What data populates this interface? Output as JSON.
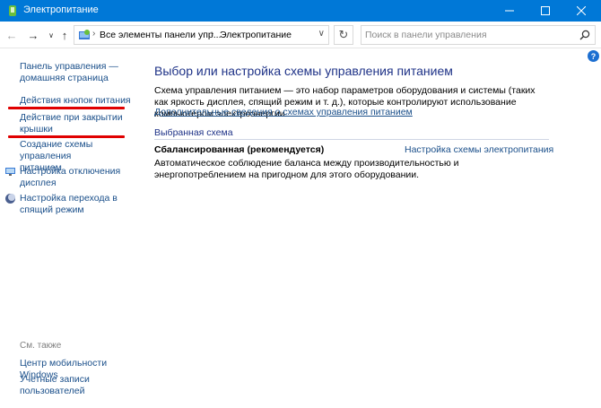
{
  "window": {
    "title": "Электропитание"
  },
  "address": {
    "crumbs": [
      "Все элементы панели упр...",
      "Электропитание"
    ]
  },
  "search": {
    "placeholder": "Поиск в панели управления"
  },
  "sidebar": {
    "items": [
      {
        "label": "Панель управления —\nдомашняя страница"
      },
      {
        "label": "Действия кнопок питания"
      },
      {
        "label": "Действие при закрытии\nкрышки"
      },
      {
        "label": "Создание схемы управления\nпитанием"
      },
      {
        "label": "Настройка отключения\nдисплея"
      },
      {
        "label": "Настройка перехода в\nспящий режим"
      }
    ],
    "see_also_title": "См. также",
    "see_also": [
      {
        "label": "Центр мобильности Windows"
      },
      {
        "label": "Учетные записи\nпользователей"
      }
    ]
  },
  "main": {
    "heading": "Выбор или настройка схемы управления питанием",
    "description": "Схема управления питанием — это набор параметров оборудования и системы (таких как яркость дисплея, спящий режим и т. д.), которые контролируют использование компьютером электроэнергии.",
    "more_link": "Дополнительные сведения о схемах управления питанием",
    "section_title": "Выбранная схема",
    "plan": {
      "name": "Сбалансированная (рекомендуется)",
      "settings_link": "Настройка схемы электропитания",
      "description": "Автоматическое соблюдение баланса между производительностью и энергопотреблением на пригодном для этого оборудовании."
    }
  },
  "help_label": "?",
  "colors": {
    "titlebar": "#0078d7",
    "link": "#1a4f8a",
    "heading": "#1e3287",
    "annotation_underline": "#e00000"
  }
}
